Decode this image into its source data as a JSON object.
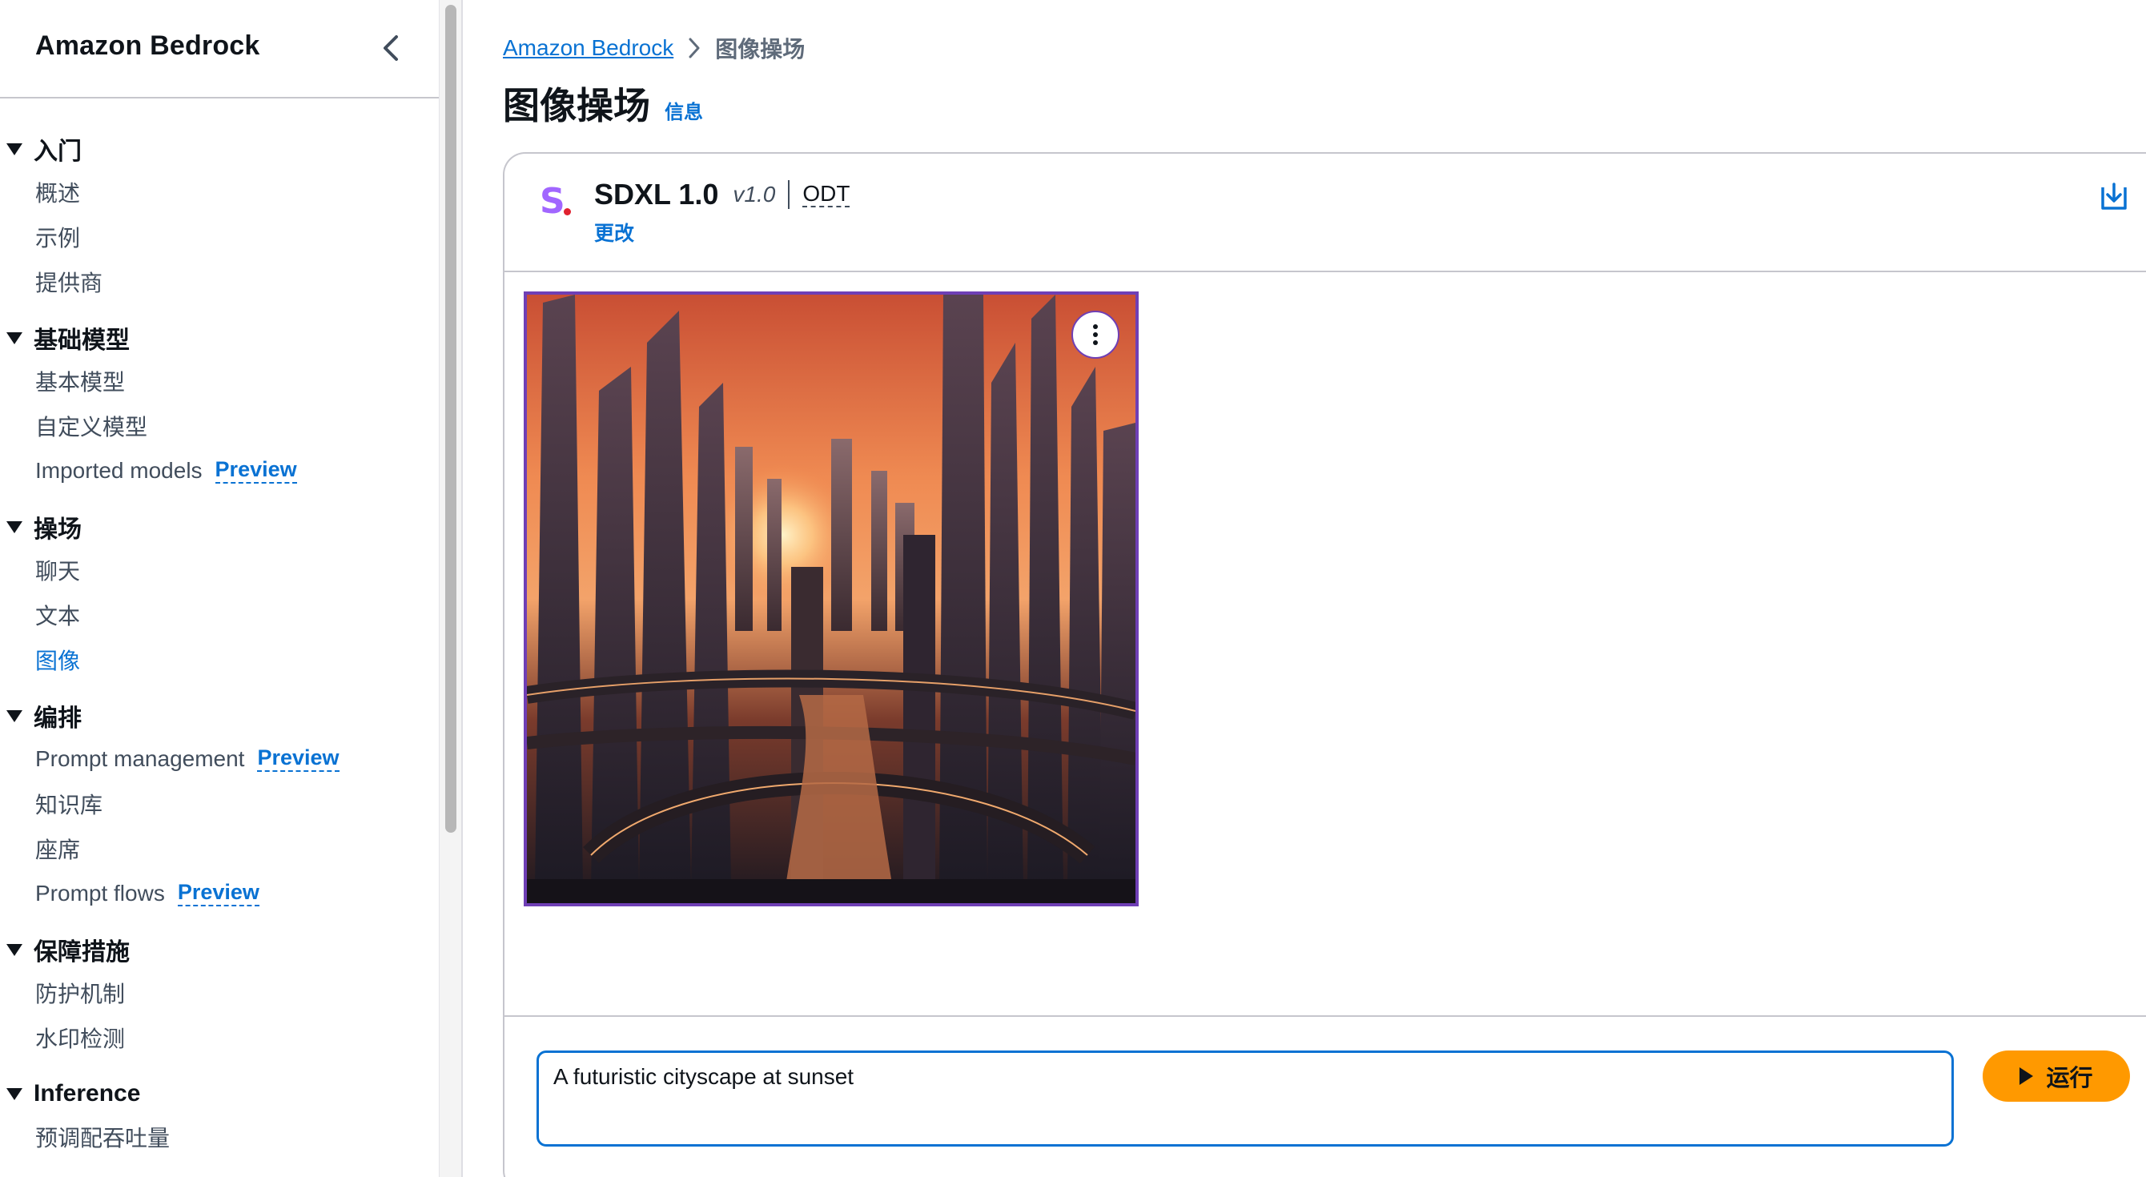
{
  "sidebar": {
    "title": "Amazon Bedrock",
    "sections": [
      {
        "title": "入门",
        "items": [
          {
            "label": "概述"
          },
          {
            "label": "示例"
          },
          {
            "label": "提供商"
          }
        ]
      },
      {
        "title": "基础模型",
        "items": [
          {
            "label": "基本模型"
          },
          {
            "label": "自定义模型"
          },
          {
            "label": "Imported models",
            "badge": "Preview"
          }
        ]
      },
      {
        "title": "操场",
        "items": [
          {
            "label": "聊天"
          },
          {
            "label": "文本"
          },
          {
            "label": "图像",
            "active": true
          }
        ]
      },
      {
        "title": "编排",
        "items": [
          {
            "label": "Prompt management",
            "badge": "Preview"
          },
          {
            "label": "知识库"
          },
          {
            "label": "座席"
          },
          {
            "label": "Prompt flows",
            "badge": "Preview"
          }
        ]
      },
      {
        "title": "保障措施",
        "items": [
          {
            "label": "防护机制"
          },
          {
            "label": "水印检测"
          }
        ]
      },
      {
        "title": "Inference",
        "items": [
          {
            "label": "预调配吞吐量"
          }
        ]
      }
    ]
  },
  "breadcrumb": {
    "root": "Amazon Bedrock",
    "current": "图像操场"
  },
  "page": {
    "title": "图像操场",
    "info": "信息"
  },
  "model": {
    "logo": "S",
    "name": "SDXL 1.0",
    "version": "v1.0",
    "tag": "ODT",
    "change_label": "更改"
  },
  "prompt": {
    "value": "A futuristic cityscape at sunset",
    "run_label": "运行"
  },
  "colors": {
    "link": "#0972d3",
    "run_button": "#ff9900",
    "image_border": "#6f3fb5",
    "logo": "#a166ff"
  },
  "icons": {
    "collapse": "chevron-left-icon",
    "breadcrumb_sep": "chevron-right-icon",
    "download": "download-icon",
    "image_menu": "more-vertical-icon",
    "run": "play-icon",
    "section_toggle": "caret-down-icon"
  }
}
